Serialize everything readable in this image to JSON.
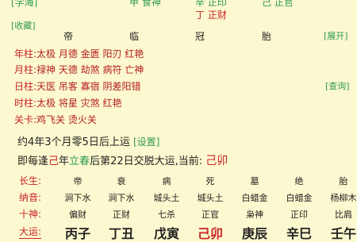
{
  "top": {
    "left_link": "[学海]",
    "col1": "甲 食神",
    "col2a": "辛 正印",
    "col2b": "丁 正财",
    "col3": "己 正官"
  },
  "collect_link": "[收藏]",
  "expand_link": "[展开]",
  "stages": [
    "帝",
    "临",
    "冠",
    "胎"
  ],
  "shensha": [
    {
      "label": "年柱:",
      "text": "太极 月德 金匮 阳刃 红艳"
    },
    {
      "label": "月柱:",
      "text": "禄神 天德 劫煞 病符 亡神"
    },
    {
      "label": "日柱:",
      "text": "天医 吊客 寡宿 阴差阳错"
    },
    {
      "label": "时柱:",
      "text": "太极 将星 灾煞 红艳"
    },
    {
      "label": "关卡:",
      "text": "鸡飞关 烫火关"
    }
  ],
  "query_link": "[查询]",
  "luck_start": "约4年3个月零5日后上运",
  "settings_link": "[设置]",
  "jiaoyun": {
    "prefix": "即每逢",
    "gan": "己",
    "year": "年",
    "term": "立春",
    "mid": "后第",
    "day": "22",
    "suffix": "日交脱大运,当前:",
    "current": "己卯"
  },
  "grid": {
    "changsheng": {
      "label": "长生:",
      "values": [
        "帝",
        "衰",
        "病",
        "死",
        "墓",
        "绝",
        "胎"
      ]
    },
    "nayin": {
      "label": "纳音:",
      "values": [
        "涧下水",
        "涧下水",
        "城头土",
        "城头土",
        "白蜡金",
        "白蜡金",
        "杨柳木"
      ]
    },
    "shishen": {
      "label": "十神:",
      "values": [
        "偏财",
        "正财",
        "七杀",
        "正官",
        "枭神",
        "正印",
        "比肩"
      ]
    },
    "dayun": {
      "label": "大运:",
      "values": [
        "丙子",
        "丁丑",
        "戊寅",
        "己卯",
        "庚辰",
        "辛巳",
        "壬午"
      ]
    }
  }
}
